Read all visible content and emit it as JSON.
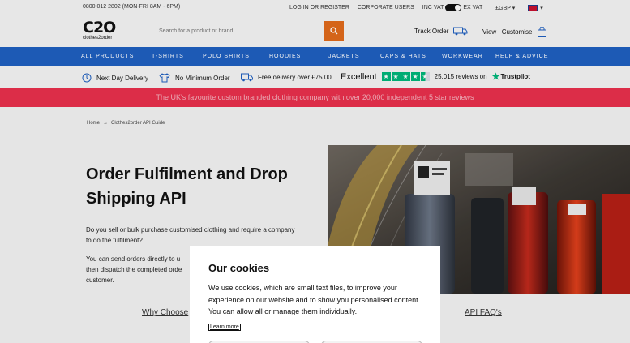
{
  "topbar": {
    "phone": "0800 012 2802 (MON-FRI 8AM - 6PM)",
    "login": "LOG IN OR REGISTER",
    "corporate": "CORPORATE USERS",
    "inc_vat": "INC VAT",
    "ex_vat": "EX VAT",
    "currency": "£GBP"
  },
  "header": {
    "logo_main": "C2O",
    "logo_sub": "clothes2order",
    "search_placeholder": "Search for a product or brand",
    "track_order": "Track Order",
    "view_customise": "View | Customise"
  },
  "nav": {
    "items": [
      "ALL PRODUCTS",
      "T-SHIRTS",
      "POLO SHIRTS",
      "HOODIES",
      "JACKETS",
      "CAPS & HATS",
      "WORKWEAR",
      "HELP & ADVICE"
    ]
  },
  "usp": {
    "next_day": "Next Day Delivery",
    "no_minimum": "No Minimum Order",
    "free_delivery": "Free delivery over £75.00",
    "rating_word": "Excellent",
    "reviews": "25,015 reviews on",
    "trustpilot": "Trustpilot"
  },
  "banner": {
    "text": "The UK's favourite custom branded clothing company with over 20,000 independent 5 star reviews"
  },
  "breadcrumb": {
    "home": "Home",
    "separator": "→",
    "current": "Clothes2order API Guide"
  },
  "hero": {
    "title": "Order Fulfilment and Drop Shipping API",
    "paragraph1": "Do you sell or bulk purchase customised clothing and require a company to do the fulfilment?",
    "paragraph2": "You can send orders directly to u",
    "paragraph2_line2": "then dispatch the completed orde",
    "paragraph2_line3": "customer."
  },
  "links": {
    "why_choose": "Why Choose",
    "api_faqs": "API FAQ's"
  },
  "cookies": {
    "title": "Our cookies",
    "body": "We use cookies, which are small text files, to improve your experience on our website and to show you personalised content. You can allow all or manage them individually.",
    "learn_more": "Learn more"
  },
  "colors": {
    "nav_blue": "#1f5fbf",
    "banner_red": "#e8304c",
    "search_orange": "#e06a1b",
    "trustpilot_green": "#00b67a"
  }
}
